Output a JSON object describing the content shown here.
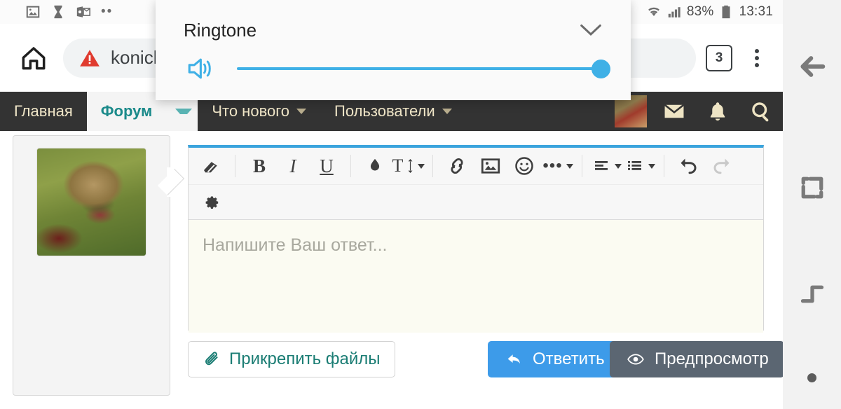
{
  "status_bar": {
    "left_icons": [
      "image-icon",
      "hourglass-icon",
      "outlook-icon",
      "more-dots-icon"
    ],
    "wifi_icon": "wifi-icon",
    "signal_icon": "signal-bars-icon",
    "battery_percent": "83%",
    "battery_icon": "battery-icon",
    "clock": "13:31"
  },
  "browser": {
    "home_icon": "home-icon",
    "security_icon": "warning-triangle-icon",
    "url": "koniclu…zvrat",
    "tab_count": "3",
    "menu_icon": "overflow-menu-icon"
  },
  "forum_nav": {
    "items": [
      {
        "label": "Главная",
        "has_caret": false,
        "active": false
      },
      {
        "label": "Форум",
        "has_caret": true,
        "active": true
      },
      {
        "label": "Что нового",
        "has_caret": true,
        "active": false
      },
      {
        "label": "Пользователи",
        "has_caret": true,
        "active": false
      }
    ],
    "right_icons": [
      "avatar",
      "inbox-envelope-icon",
      "alerts-bell-icon",
      "search-icon"
    ],
    "background": "#333333",
    "link_color": "#f0e6c8",
    "active_color": "#1b8a8a"
  },
  "post": {
    "avatar_name": "user-avatar-lion"
  },
  "editor": {
    "accent_color": "#3ba4dd",
    "toolbar_row1": [
      {
        "name": "remove-formatting-icon",
        "label": ""
      },
      {
        "name": "bold-icon",
        "label": "B"
      },
      {
        "name": "italic-icon",
        "label": "I"
      },
      {
        "name": "underline-icon",
        "label": "U"
      },
      {
        "name": "text-color-icon",
        "label": ""
      },
      {
        "name": "font-size-icon",
        "label": "T"
      },
      {
        "name": "insert-link-icon",
        "label": ""
      },
      {
        "name": "insert-image-icon",
        "label": ""
      },
      {
        "name": "insert-smilie-icon",
        "label": ""
      },
      {
        "name": "more-options-icon",
        "label": ""
      },
      {
        "name": "text-align-icon",
        "label": ""
      },
      {
        "name": "list-icon",
        "label": ""
      },
      {
        "name": "undo-icon",
        "label": ""
      },
      {
        "name": "redo-icon",
        "label": ""
      }
    ],
    "toolbar_row2": [
      {
        "name": "editor-settings-gear-icon",
        "label": ""
      }
    ],
    "placeholder": "Напишите Ваш ответ...",
    "textarea_value": "",
    "textarea_background": "#fbfbf2"
  },
  "actions": {
    "attach": {
      "label": "Прикрепить файлы",
      "icon": "paperclip-icon",
      "color": "#1b7d74"
    },
    "reply": {
      "label": "Ответить",
      "icon": "reply-arrow-icon",
      "color": "#3d9be9"
    },
    "preview": {
      "label": "Предпросмотр",
      "icon": "eye-icon",
      "color": "#5b6672"
    }
  },
  "volume_panel": {
    "title": "Ringtone",
    "expand_icon": "chevron-down-icon",
    "speaker_icon": "speaker-volume-icon",
    "slider_value": 100,
    "slider_color": "#3fb0e6"
  },
  "system_nav": {
    "buttons": [
      "back-icon",
      "recents-icon",
      "home-icon",
      "nav-dot"
    ]
  }
}
